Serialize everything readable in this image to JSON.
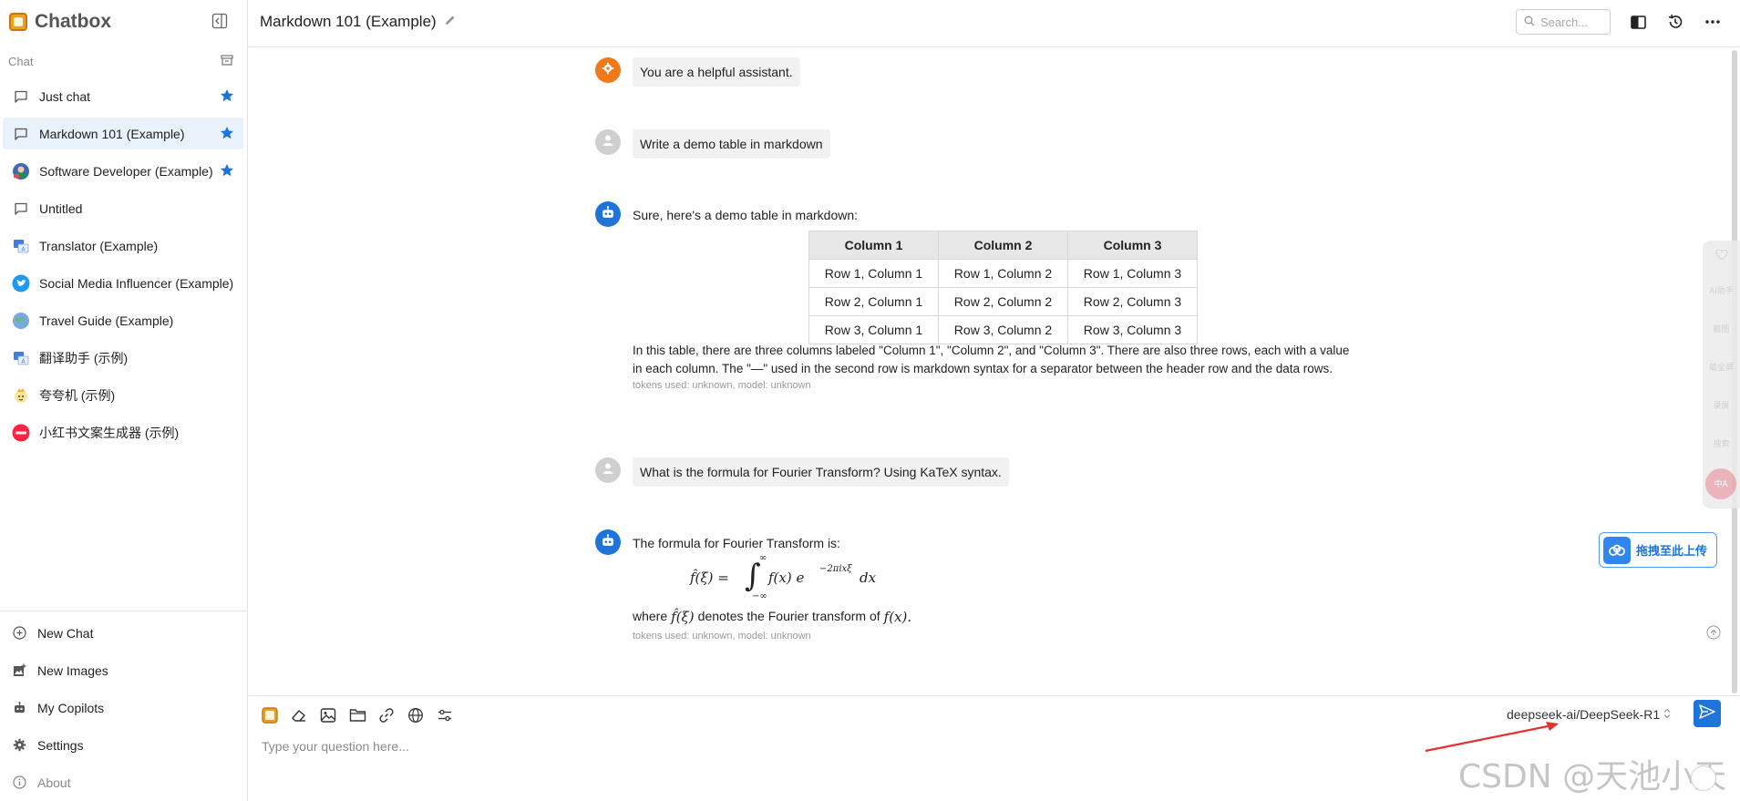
{
  "app": {
    "name": "Chatbox"
  },
  "sidebar": {
    "section_label": "Chat",
    "chats": [
      {
        "label": "Just chat",
        "starred": true,
        "icon": "chat-bubble-icon"
      },
      {
        "label": "Markdown 101 (Example)",
        "starred": true,
        "icon": "chat-bubble-icon",
        "active": true
      },
      {
        "label": "Software Developer (Example)",
        "starred": true,
        "icon": "developer-avatar"
      },
      {
        "label": "Untitled",
        "starred": false,
        "icon": "chat-bubble-icon"
      },
      {
        "label": "Translator (Example)",
        "starred": false,
        "icon": "translator-avatar"
      },
      {
        "label": "Social Media Influencer (Example)",
        "starred": false,
        "icon": "twitter-bird-avatar"
      },
      {
        "label": "Travel Guide (Example)",
        "starred": false,
        "icon": "globe-avatar"
      },
      {
        "label": "翻译助手 (示例)",
        "starred": false,
        "icon": "translator-avatar"
      },
      {
        "label": "夸夸机 (示例)",
        "starred": false,
        "icon": "praise-avatar"
      },
      {
        "label": "小红书文案生成器 (示例)",
        "starred": false,
        "icon": "xiaohongshu-avatar"
      }
    ],
    "footer": {
      "new_chat": "New Chat",
      "new_images": "New Images",
      "my_copilots": "My Copilots",
      "settings": "Settings",
      "about": "About"
    }
  },
  "header": {
    "title": "Markdown 101 (Example)",
    "search_placeholder": "Search..."
  },
  "messages": {
    "system": "You are a helpful assistant.",
    "user1": "Write a demo table in markdown",
    "assistant1": {
      "intro": "Sure, here's a demo table in markdown:",
      "table": {
        "headers": [
          "Column 1",
          "Column 2",
          "Column 3"
        ],
        "rows": [
          [
            "Row 1, Column 1",
            "Row 1, Column 2",
            "Row 1, Column 3"
          ],
          [
            "Row 2, Column 1",
            "Row 2, Column 2",
            "Row 2, Column 3"
          ],
          [
            "Row 3, Column 1",
            "Row 3, Column 2",
            "Row 3, Column 3"
          ]
        ]
      },
      "para_line1": "In this table, there are three columns labeled \"Column 1\", \"Column 2\", and \"Column 3\". There are also three rows, each with a value",
      "para_line2": "in each column. The \"—\" used in the second row is markdown syntax for a separator between the header row and the data rows.",
      "meta": "tokens used: unknown, model: unknown"
    },
    "user2": "What is the formula for Fourier Transform? Using KaTeX syntax.",
    "assistant2": {
      "intro": "The formula for Fourier Transform is:",
      "formula_lhs": "f̂(ξ) =",
      "formula_upper": "∞",
      "formula_lower": "−∞",
      "formula_body": "f(x) e",
      "formula_exp": "−2πixξ",
      "formula_dx": "dx",
      "where_prefix": "where",
      "where_fhat": "f̂(ξ)",
      "where_mid": "denotes the Fourier transform of",
      "where_fx": "f(x).",
      "meta": "tokens used: unknown, model: unknown"
    }
  },
  "composer": {
    "model": "deepseek-ai/DeepSeek-R1",
    "placeholder": "Type your question here..."
  },
  "overlays": {
    "side_panel_items": [
      "AI助手",
      "截图",
      "截全屏",
      "录屏",
      "搜索",
      "中A"
    ],
    "upload_label": "拖拽至此上传",
    "watermark": "CSDN @天池小天"
  },
  "colors": {
    "accent": "#1e74d8",
    "system_avatar": "#f07a1a",
    "assistant_avatar": "#1e74d8",
    "user_avatar": "#cfcfcf",
    "active_row": "#e9f1fb"
  }
}
